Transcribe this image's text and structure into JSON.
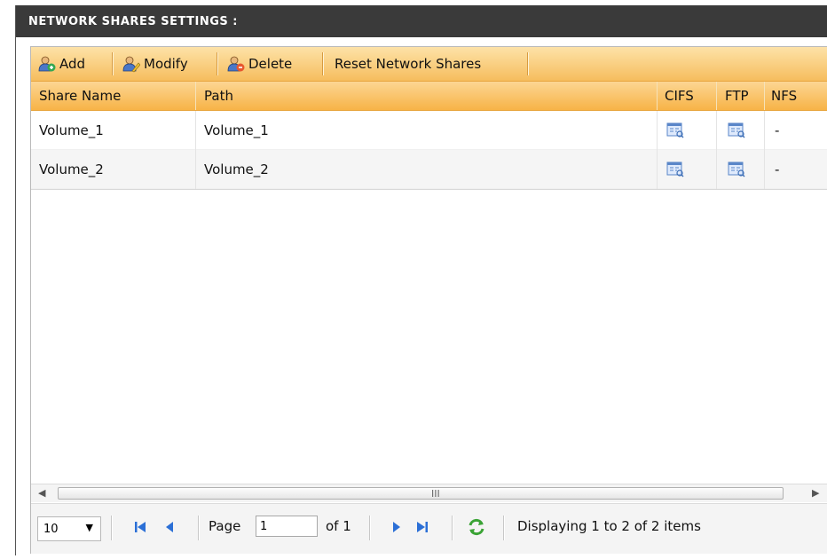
{
  "panel": {
    "title": "NETWORK SHARES SETTINGS :"
  },
  "toolbar": {
    "add_label": "Add",
    "modify_label": "Modify",
    "delete_label": "Delete",
    "reset_label": "Reset Network Shares"
  },
  "table": {
    "columns": [
      "Share Name",
      "Path",
      "CIFS",
      "FTP",
      "NFS"
    ],
    "rows": [
      {
        "share_name": "Volume_1",
        "path": "Volume_1",
        "cifs": "details-icon",
        "ftp": "details-icon",
        "nfs": "-"
      },
      {
        "share_name": "Volume_2",
        "path": "Volume_2",
        "cifs": "details-icon",
        "ftp": "details-icon",
        "nfs": "-"
      }
    ]
  },
  "scrollbar": {
    "grip": "III"
  },
  "pager": {
    "page_size": "10",
    "page_label": "Page",
    "page_value": "1",
    "of_label": "of 1",
    "status": "Displaying 1 to 2 of 2 items"
  },
  "colors": {
    "toolbar": "#f6bd5d",
    "header": "#f7b347",
    "titlebar": "#3a3a3a",
    "nav_blue": "#2b6fd6",
    "refresh_green": "#3aa335"
  }
}
